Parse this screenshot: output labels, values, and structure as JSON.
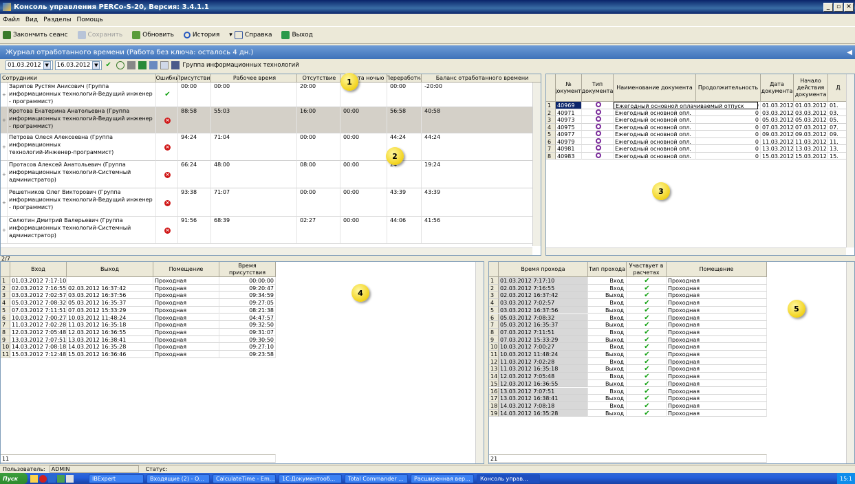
{
  "window": {
    "title": "Консоль управления PERCo-S-20, Версия: 3.4.1.1",
    "buttons": [
      "_",
      "▫",
      "✕"
    ]
  },
  "menu": [
    "Файл",
    "Вид",
    "Разделы",
    "Помощь"
  ],
  "toolbar": {
    "end_session": "Закончить сеанс",
    "save": "Сохранить",
    "refresh": "Обновить",
    "history": "История",
    "help": "Справка",
    "exit": "Выход"
  },
  "section_title": "Журнал отработанного времени (Работа без ключа: осталось 4 дн.)",
  "filter": {
    "date_from": "01.03.2012",
    "date_to": "16.03.2012",
    "group": "Группа информационных технологий"
  },
  "employees": {
    "headers": [
      "Сотрудники",
      "Ошибки",
      "Присутствие",
      "Рабочее время",
      "Отсутствие",
      "Работа ночью",
      "Переработка",
      "Баланс отработанного времени"
    ],
    "rows": [
      {
        "name": [
          "Зарипов Рустям Анисович (Группа",
          "информационных технологий-Ведущий инженер",
          "- программист)"
        ],
        "status": "ok",
        "presence": "00:00",
        "work": "00:00",
        "absence": "20:00",
        "night": "",
        "overtime": "00:00",
        "balance": "-20:00"
      },
      {
        "name": [
          "Кротова Екатерина Анатольевна (Группа",
          "информационных технологий-Ведущий инженер",
          "- программист)"
        ],
        "status": "err",
        "presence": "88:58",
        "work": "55:03",
        "absence": "16:00",
        "night": "00:00",
        "overtime": "56:58",
        "balance": "40:58"
      },
      {
        "name": [
          "Петрова Олеся Алексеевна (Группа",
          "информационных",
          "технологий-Инженер-программист)"
        ],
        "status": "err",
        "presence": "94:24",
        "work": "71:04",
        "absence": "00:00",
        "night": "00:00",
        "overtime": "44:24",
        "balance": "44:24"
      },
      {
        "name": [
          "Протасов Алексей Анатольевич (Группа",
          "информационных технологий-Системный",
          "администратор)"
        ],
        "status": "err",
        "presence": "66:24",
        "work": "48:00",
        "absence": "08:00",
        "night": "00:00",
        "overtime": "24",
        "balance": "19:24"
      },
      {
        "name": [
          "Решетников Олег Викторович (Группа",
          "информационных технологий-Ведущий инженер",
          "- программист)"
        ],
        "status": "err",
        "presence": "93:38",
        "work": "71:07",
        "absence": "00:00",
        "night": "00:00",
        "overtime": "43:39",
        "balance": "43:39"
      },
      {
        "name": [
          "Селютин Дмитрий Валерьевич (Группа",
          "информационных технологий-Системный",
          "администратор)"
        ],
        "status": "err",
        "presence": "91:56",
        "work": "68:39",
        "absence": "02:27",
        "night": "00:00",
        "overtime": "44:06",
        "balance": "41:56"
      }
    ],
    "footer": "2/7"
  },
  "documents": {
    "headers": [
      "№ Документа",
      "Тип документа",
      "Наименование документа",
      "Продолжительность",
      "Дата документа",
      "Начало действия документа",
      "Д"
    ],
    "rows": [
      {
        "n": "1",
        "no": "40969",
        "name": "Ежегодный основной оплачиваемый отпуск",
        "dur": "0",
        "date": "01.03.2012",
        "start": "01.03.2012",
        "d": "01."
      },
      {
        "n": "2",
        "no": "40971",
        "name": "Ежегодный основной опл.",
        "dur": "0",
        "date": "03.03.2012",
        "start": "03.03.2012",
        "d": "03."
      },
      {
        "n": "3",
        "no": "40973",
        "name": "Ежегодный основной опл.",
        "dur": "0",
        "date": "05.03.2012",
        "start": "05.03.2012",
        "d": "05."
      },
      {
        "n": "4",
        "no": "40975",
        "name": "Ежегодный основной опл.",
        "dur": "0",
        "date": "07.03.2012",
        "start": "07.03.2012",
        "d": "07."
      },
      {
        "n": "5",
        "no": "40977",
        "name": "Ежегодный основной опл.",
        "dur": "0",
        "date": "09.03.2012",
        "start": "09.03.2012",
        "d": "09."
      },
      {
        "n": "6",
        "no": "40979",
        "name": "Ежегодный основной опл.",
        "dur": "0",
        "date": "11.03.2012",
        "start": "11.03.2012",
        "d": "11."
      },
      {
        "n": "7",
        "no": "40981",
        "name": "Ежегодный основной опл.",
        "dur": "0",
        "date": "13.03.2012",
        "start": "13.03.2012",
        "d": "13."
      },
      {
        "n": "8",
        "no": "40983",
        "name": "Ежегодный основной опл.",
        "dur": "0",
        "date": "15.03.2012",
        "start": "15.03.2012",
        "d": "15."
      }
    ]
  },
  "visits": {
    "headers": [
      "Вход",
      "Выход",
      "Помещение",
      "Время присутствия"
    ],
    "rows": [
      [
        "01.03.2012 7:17:10",
        "",
        "Проходная",
        "00:00:00"
      ],
      [
        "02.03.2012 7:16:55",
        "02.03.2012 16:37:42",
        "Проходная",
        "09:20:47"
      ],
      [
        "03.03.2012 7:02:57",
        "03.03.2012 16:37:56",
        "Проходная",
        "09:34:59"
      ],
      [
        "05.03.2012 7:08:32",
        "05.03.2012 16:35:37",
        "Проходная",
        "09:27:05"
      ],
      [
        "07.03.2012 7:11:51",
        "07.03.2012 15:33:29",
        "Проходная",
        "08:21:38"
      ],
      [
        "10.03.2012 7:00:27",
        "10.03.2012 11:48:24",
        "Проходная",
        "04:47:57"
      ],
      [
        "11.03.2012 7:02:28",
        "11.03.2012 16:35:18",
        "Проходная",
        "09:32:50"
      ],
      [
        "12.03.2012 7:05:48",
        "12.03.2012 16:36:55",
        "Проходная",
        "09:31:07"
      ],
      [
        "13.03.2012 7:07:51",
        "13.03.2012 16:38:41",
        "Проходная",
        "09:30:50"
      ],
      [
        "14.03.2012 7:08:18",
        "14.03.2012 16:35:28",
        "Проходная",
        "09:27:10"
      ],
      [
        "15.03.2012 7:12:48",
        "15.03.2012 16:36:46",
        "Проходная",
        "09:23:58"
      ]
    ],
    "footer": "11"
  },
  "passes": {
    "headers": [
      "Время прохода",
      "Тип прохода",
      "Участвует в расчетах",
      "Помещение"
    ],
    "rows": [
      [
        "01.03.2012 7:17:10",
        "Вход",
        "Проходная"
      ],
      [
        "02.03.2012 7:16:55",
        "Вход",
        "Проходная"
      ],
      [
        "02.03.2012 16:37:42",
        "Выход",
        "Проходная"
      ],
      [
        "03.03.2012 7:02:57",
        "Вход",
        "Проходная"
      ],
      [
        "03.03.2012 16:37:56",
        "Выход",
        "Проходная"
      ],
      [
        "05.03.2012 7:08:32",
        "Вход",
        "Проходная"
      ],
      [
        "05.03.2012 16:35:37",
        "Выход",
        "Проходная"
      ],
      [
        "07.03.2012 7:11:51",
        "Вход",
        "Проходная"
      ],
      [
        "07.03.2012 15:33:29",
        "Выход",
        "Проходная"
      ],
      [
        "10.03.2012 7:00:27",
        "Вход",
        "Проходная"
      ],
      [
        "10.03.2012 11:48:24",
        "Выход",
        "Проходная"
      ],
      [
        "11.03.2012 7:02:28",
        "Вход",
        "Проходная"
      ],
      [
        "11.03.2012 16:35:18",
        "Выход",
        "Проходная"
      ],
      [
        "12.03.2012 7:05:48",
        "Вход",
        "Проходная"
      ],
      [
        "12.03.2012 16:36:55",
        "Выход",
        "Проходная"
      ],
      [
        "13.03.2012 7:07:51",
        "Вход",
        "Проходная"
      ],
      [
        "13.03.2012 16:38:41",
        "Выход",
        "Проходная"
      ],
      [
        "14.03.2012 7:08:18",
        "Вход",
        "Проходная"
      ],
      [
        "14.03.2012 16:35:28",
        "Выход",
        "Проходная"
      ]
    ],
    "footer": "21"
  },
  "markers": [
    "1",
    "2",
    "3",
    "4",
    "5"
  ],
  "status": {
    "user_label": "Пользователь:",
    "user": "ADMIN",
    "status_label": "Статус:"
  },
  "taskbar": {
    "start": "Пуск",
    "items": [
      "IBExpert",
      "Входящие (2) - О...",
      "CalculateTime - Em...",
      "1С:Документооб...",
      "Total Commander ...",
      "Расширенная вер...",
      "Консоль управ..."
    ],
    "clock": "15:1"
  },
  "colors": {
    "title": "#0a246a",
    "section": "#3e72b9",
    "selected": "#d4d0c8",
    "marker": "#f2d21b"
  }
}
